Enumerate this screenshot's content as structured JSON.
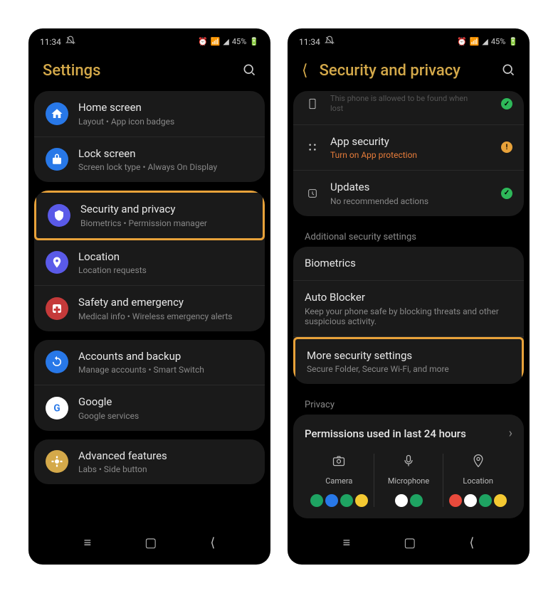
{
  "status": {
    "time": "11:34",
    "battery": "45%"
  },
  "left": {
    "title": "Settings",
    "groups": [
      {
        "items": [
          {
            "icon": "home",
            "bg": "#2878e8",
            "title": "Home screen",
            "sub": "Layout  •  App icon badges"
          },
          {
            "icon": "lock",
            "bg": "#2878e8",
            "title": "Lock screen",
            "sub": "Screen lock type  •  Always On Display"
          }
        ]
      },
      {
        "highlight_index": 0,
        "items": [
          {
            "icon": "shield",
            "bg": "#5a5ae8",
            "title": "Security and privacy",
            "sub": "Biometrics  •  Permission manager"
          },
          {
            "icon": "pin",
            "bg": "#5a5ae8",
            "title": "Location",
            "sub": "Location requests"
          },
          {
            "icon": "medical",
            "bg": "#c53a3a",
            "title": "Safety and emergency",
            "sub": "Medical info  •  Wireless emergency alerts"
          }
        ]
      },
      {
        "items": [
          {
            "icon": "sync",
            "bg": "#2878e8",
            "title": "Accounts and backup",
            "sub": "Manage accounts  •  Smart Switch"
          },
          {
            "icon": "google",
            "bg": "#fff",
            "title": "Google",
            "sub": "Google services"
          }
        ]
      },
      {
        "items": [
          {
            "icon": "star",
            "bg": "#d4a94a",
            "title": "Advanced features",
            "sub": "Labs  •  Side button"
          }
        ]
      }
    ]
  },
  "right": {
    "title": "Security and privacy",
    "top_items": [
      {
        "icon": "phone",
        "title_cut": "This phone is allowed to be found when",
        "sub": "lost",
        "status": "green"
      },
      {
        "icon": "apps",
        "title": "App security",
        "sub": "Turn on App protection",
        "sub_style": "orange",
        "status": "orange"
      },
      {
        "icon": "update",
        "title": "Updates",
        "sub": "No recommended actions",
        "status": "green"
      }
    ],
    "section1": "Additional security settings",
    "sec_items": [
      {
        "title": "Biometrics"
      },
      {
        "title": "Auto Blocker",
        "sub": "Keep your phone safe by blocking threats and other suspicious activity."
      },
      {
        "title": "More security settings",
        "sub": "Secure Folder, Secure Wi-Fi, and more",
        "highlight": true
      }
    ],
    "section2": "Privacy",
    "perm": {
      "title": "Permissions used in last 24 hours",
      "cols": [
        {
          "icon": "camera",
          "label": "Camera",
          "apps": [
            "ag",
            "ab",
            "ago",
            "ay"
          ]
        },
        {
          "icon": "mic",
          "label": "Microphone",
          "apps": [
            "aw",
            "ag"
          ]
        },
        {
          "icon": "loc",
          "label": "Location",
          "apps": [
            "ar",
            "aw",
            "ago",
            "ay"
          ]
        }
      ]
    }
  }
}
